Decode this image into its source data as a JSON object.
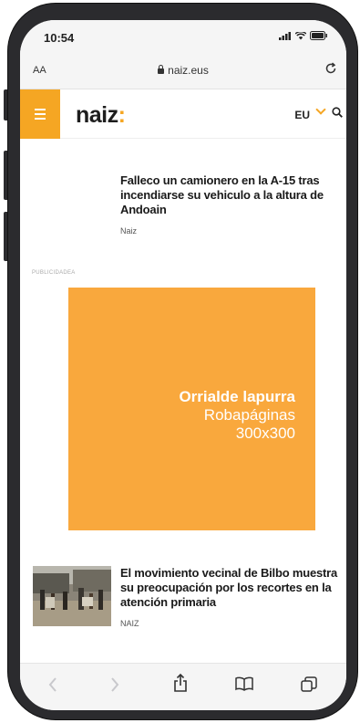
{
  "status_bar": {
    "time": "10:54"
  },
  "url_bar": {
    "text_size_label": "AA",
    "url": "naiz.eus"
  },
  "site_header": {
    "logo_text": "naiz",
    "logo_colon": ":",
    "language": "EU"
  },
  "articles": [
    {
      "title": "Falleco un camionero en la A-15 tras incendiarse su vehiculo a la altura de Andoain",
      "source": "Naiz"
    },
    {
      "title": "El movimiento vecinal de Bilbo muestra su preocupación por los recortes en la atención primaria",
      "source": "NAIZ"
    }
  ],
  "ad": {
    "label": "PUBLICIDADEA",
    "title": "Orrialde lapurra",
    "type": "Robapáginas",
    "size": "300x300",
    "color": "#f9a83d"
  },
  "colors": {
    "accent": "#f5a623"
  },
  "toolbar": {
    "icons": [
      "back-icon",
      "forward-icon",
      "share-icon",
      "bookmarks-icon",
      "tabs-icon"
    ]
  }
}
